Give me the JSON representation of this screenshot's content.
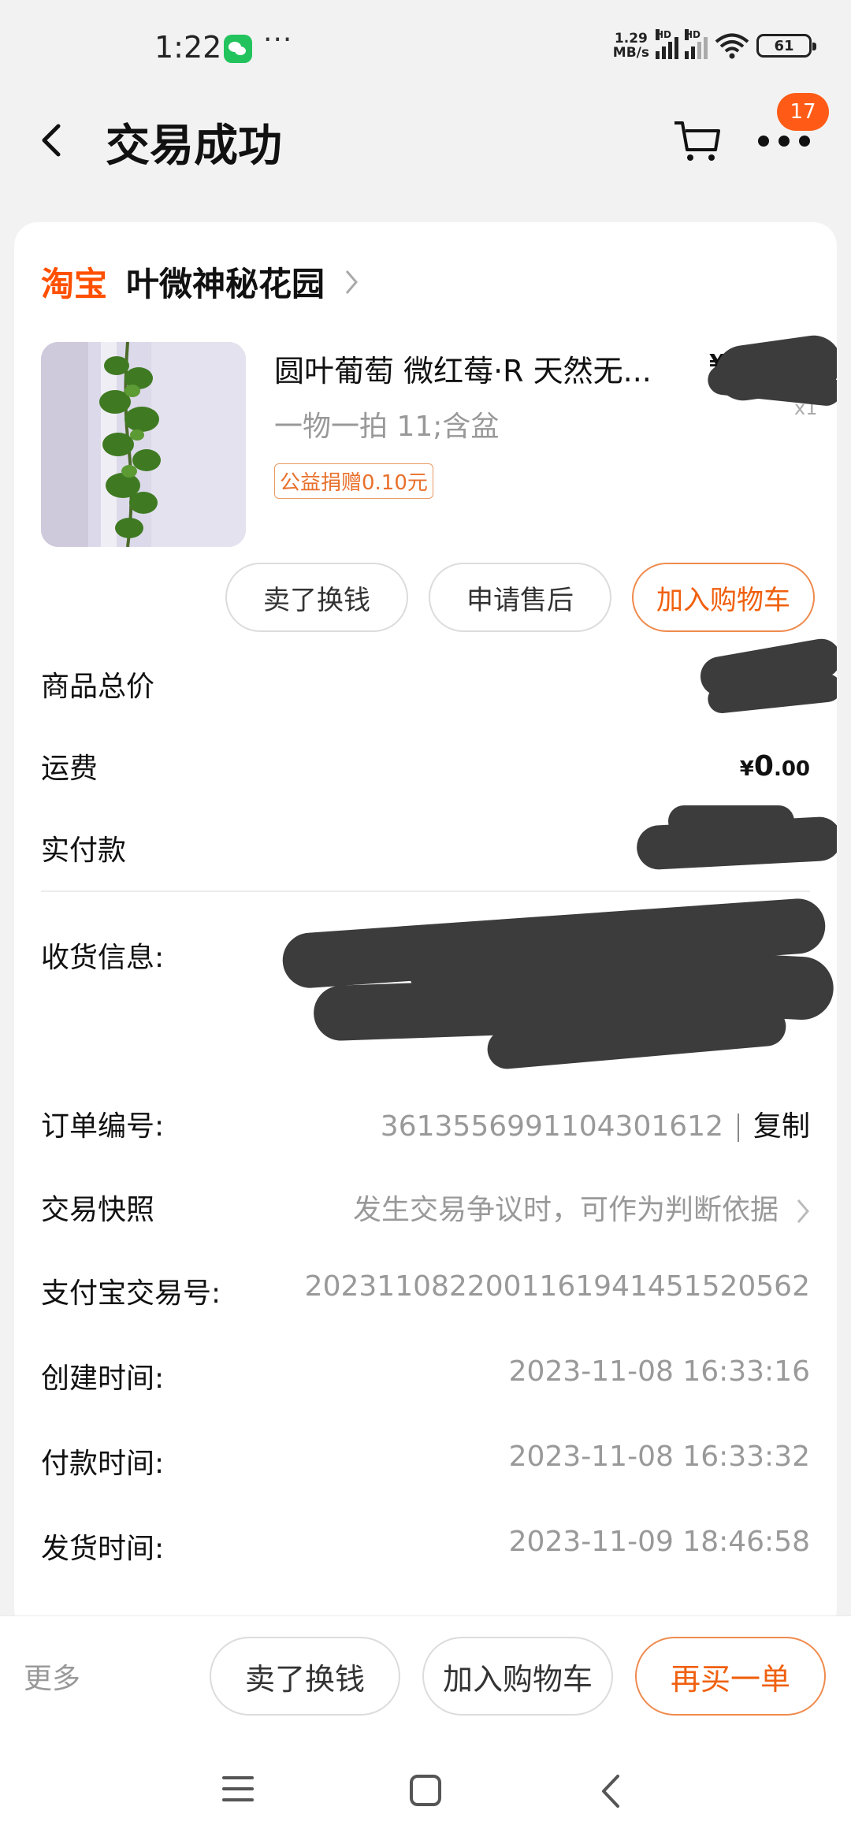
{
  "status_bar": {
    "time": "1:22",
    "dots": "···",
    "net_speed_value": "1.29",
    "net_speed_unit": "MB/s",
    "signal_label": "HD",
    "battery": "61"
  },
  "header": {
    "title": "交易成功",
    "notification_count": "17"
  },
  "shop": {
    "logo": "淘宝",
    "name": "叶微神秘花园"
  },
  "product": {
    "title": "圆叶葡萄 微红莓·R 天然无...",
    "spec": "一物一拍 11;含盆",
    "charity_tag": "公益捐赠0.10元",
    "price_prefix": "¥",
    "qty": "x1"
  },
  "item_actions": {
    "sell": "卖了换钱",
    "after_sale": "申请售后",
    "add_cart": "加入购物车"
  },
  "summary": {
    "goods_total_label": "商品总价",
    "shipping_label": "运费",
    "shipping_currency": "¥",
    "shipping_int": "0",
    "shipping_dec": ".00",
    "paid_label": "实付款"
  },
  "order_info": {
    "address_label": "收货信息:",
    "order_no_label": "订单编号:",
    "order_no": "3613556991104301612",
    "copy": "复制",
    "snapshot_label": "交易快照",
    "snapshot_hint": "发生交易争议时，可作为判断依据",
    "alipay_label": "支付宝交易号:",
    "alipay_no": "2023110822001161941451520562",
    "created_label": "创建时间:",
    "created_time": "2023-11-08 16:33:16",
    "paid_label": "付款时间:",
    "paid_time": "2023-11-08 16:33:32",
    "shipped_label": "发货时间:",
    "shipped_time": "2023-11-09 18:46:58"
  },
  "bottom_bar": {
    "more": "更多",
    "sell": "卖了换钱",
    "add_cart": "加入购物车",
    "buy_again": "再买一单"
  },
  "colors": {
    "accent": "#ff5000",
    "notification": "#ff5b16",
    "accent_border": "#ef8b4e"
  }
}
